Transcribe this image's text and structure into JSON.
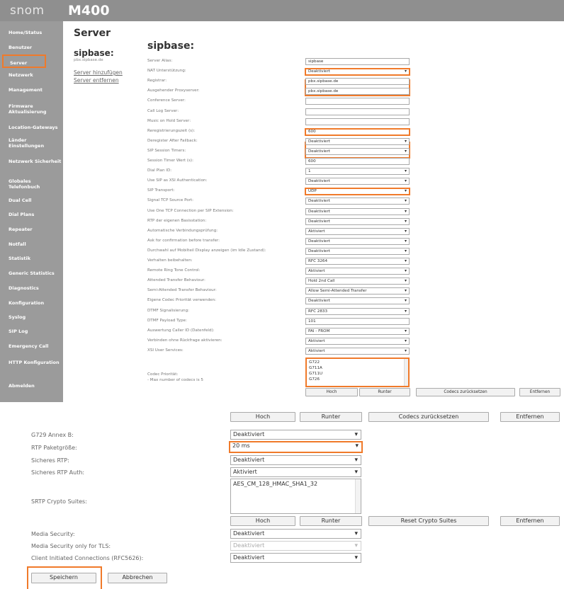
{
  "header": {
    "brand": "snom",
    "model": "M400"
  },
  "sidebar": {
    "items": [
      {
        "label": "Home/Status"
      },
      {
        "label": "Benutzer"
      },
      {
        "label": "Server",
        "active": true
      },
      {
        "label": "Netzwerk"
      },
      {
        "label": "Management"
      },
      {
        "label": "Firmware Aktualisierung"
      },
      {
        "label": "Location-Gateways"
      },
      {
        "label": "Länder Einstellungen"
      },
      {
        "label": "Netzwerk Sicherheit"
      },
      {
        "label": "Globales Telefonbuch"
      },
      {
        "label": "Dual Cell"
      },
      {
        "label": "Dial Plans"
      },
      {
        "label": "Repeater"
      },
      {
        "label": "Notfall"
      },
      {
        "label": "Statistik"
      },
      {
        "label": "Generic Statistics"
      },
      {
        "label": "Diagnostics"
      },
      {
        "label": "Konfiguration"
      },
      {
        "label": "Syslog"
      },
      {
        "label": "SIP Log"
      },
      {
        "label": "Emergency Call"
      },
      {
        "label": "HTTP Konfiguration"
      },
      {
        "label": "Abmelden"
      }
    ]
  },
  "page": {
    "title": "Server",
    "server_name": "sipbase:",
    "server_host": "pbx.sipbase.de",
    "add_server": "Server hinzufügen",
    "remove_server": "Server entfernen",
    "section_title": "sipbase:"
  },
  "fields": [
    {
      "label": "Server Alias:",
      "value": "sipbase",
      "kind": "text"
    },
    {
      "label": "NAT Unterstützung:",
      "value": "Deaktiviert",
      "kind": "select",
      "hl": true
    },
    {
      "label": "Registrar:",
      "value": "pbx.sipbase.de",
      "kind": "text"
    },
    {
      "label": "Ausgehender Proxyserver:",
      "value": "pbx.sipbase.de",
      "kind": "text"
    },
    {
      "label": "Conference Server:",
      "value": "",
      "kind": "text"
    },
    {
      "label": "Call Log Server:",
      "value": "",
      "kind": "text"
    },
    {
      "label": "Music on Hold Server:",
      "value": "",
      "kind": "text"
    },
    {
      "label": "Reregistrierungszeit (s):",
      "value": "600",
      "kind": "text",
      "hl": true
    },
    {
      "label": "Deregister After Failback:",
      "value": "Deaktiviert",
      "kind": "select"
    },
    {
      "label": "SIP Session Timers:",
      "value": "Deaktiviert",
      "kind": "select"
    },
    {
      "label": "Session Timer Wert (s):",
      "value": "600",
      "kind": "text"
    },
    {
      "label": "Dial Plan ID:",
      "value": "1",
      "kind": "select"
    },
    {
      "label": "Use SIP as XSI Authentication:",
      "value": "Deaktiviert",
      "kind": "select"
    },
    {
      "label": "SIP Transport:",
      "value": "UDP",
      "kind": "select",
      "hl": true
    },
    {
      "label": "Signal TCP Source Port:",
      "value": "Deaktiviert",
      "kind": "select"
    },
    {
      "label": "Use One TCP Connection per SIP Extension:",
      "value": "Deaktiviert",
      "kind": "select"
    },
    {
      "label": "RTP der eigenen Basisstation:",
      "value": "Deaktiviert",
      "kind": "select"
    },
    {
      "label": "Automatische Verbindungsprüfung:",
      "value": "Aktiviert",
      "kind": "select"
    },
    {
      "label": "Ask for confirmation before transfer:",
      "value": "Deaktiviert",
      "kind": "select"
    },
    {
      "label": "Durchwahl auf Mobilteil Display anzeigen (im Idle Zustand):",
      "value": "Deaktiviert",
      "kind": "select"
    },
    {
      "label": "Verhalten beibehalten:",
      "value": "RFC 3264",
      "kind": "select"
    },
    {
      "label": "Remote Ring Tone Control:",
      "value": "Aktiviert",
      "kind": "select"
    },
    {
      "label": "Attended Transfer Behaviour:",
      "value": "Hold 2nd Call",
      "kind": "select"
    },
    {
      "label": "Semi-Attended Transfer Behaviour:",
      "value": "Allow Semi-Attended Transfer",
      "kind": "select"
    },
    {
      "label": "Eigene Codec Priorität verwenden:",
      "value": "Deaktiviert",
      "kind": "select"
    },
    {
      "label": "DTMF Signalisierung:",
      "value": "RFC 2833",
      "kind": "select"
    },
    {
      "label": "DTMF Payload Type:",
      "value": "101",
      "kind": "text"
    },
    {
      "label": "Auswertung Caller ID (Datenfeld):",
      "value": "PAI - FROM",
      "kind": "select"
    },
    {
      "label": "Verbinden ohne Rückfrage aktivieren:",
      "value": "Aktiviert",
      "kind": "select"
    },
    {
      "label": "XSI User Services:",
      "value": "Aktiviert",
      "kind": "select"
    }
  ],
  "codec": {
    "label": "Codec Priorität:",
    "note": "- Max number of codecs is 5",
    "items": [
      "G722",
      "G711A",
      "G711U",
      "G726"
    ]
  },
  "buttons_top": {
    "up": "Hoch",
    "down": "Runter",
    "reset_codecs": "Codecs zurücksetzen",
    "remove": "Entfernen"
  },
  "bottom": {
    "buttons_top": {
      "up": "Hoch",
      "down": "Runter",
      "reset_codecs": "Codecs zurücksetzen",
      "remove": "Entfernen"
    },
    "fields": [
      {
        "label": "G729 Annex B:",
        "value": "Deaktiviert"
      },
      {
        "label": "RTP Paketgröße:",
        "value": "20 ms",
        "hl": true
      },
      {
        "label": "Sicheres RTP:",
        "value": "Deaktiviert"
      },
      {
        "label": "Sicheres RTP Auth:",
        "value": "Aktiviert"
      }
    ],
    "srtp": {
      "label": "SRTP Crypto Suites:",
      "items": [
        "AES_CM_128_HMAC_SHA1_32"
      ]
    },
    "buttons_mid": {
      "up": "Hoch",
      "down": "Runter",
      "reset_crypto": "Reset Crypto Suites",
      "remove": "Entfernen"
    },
    "fields2": [
      {
        "label": "Media Security:",
        "value": "Deaktiviert"
      },
      {
        "label": "Media Security only for TLS:",
        "value": "Deaktiviert",
        "disabled": true
      },
      {
        "label": "Client Initiated Connections (RFC5626):",
        "value": "Deaktiviert"
      }
    ],
    "save": "Speichern",
    "cancel": "Abbrechen"
  }
}
